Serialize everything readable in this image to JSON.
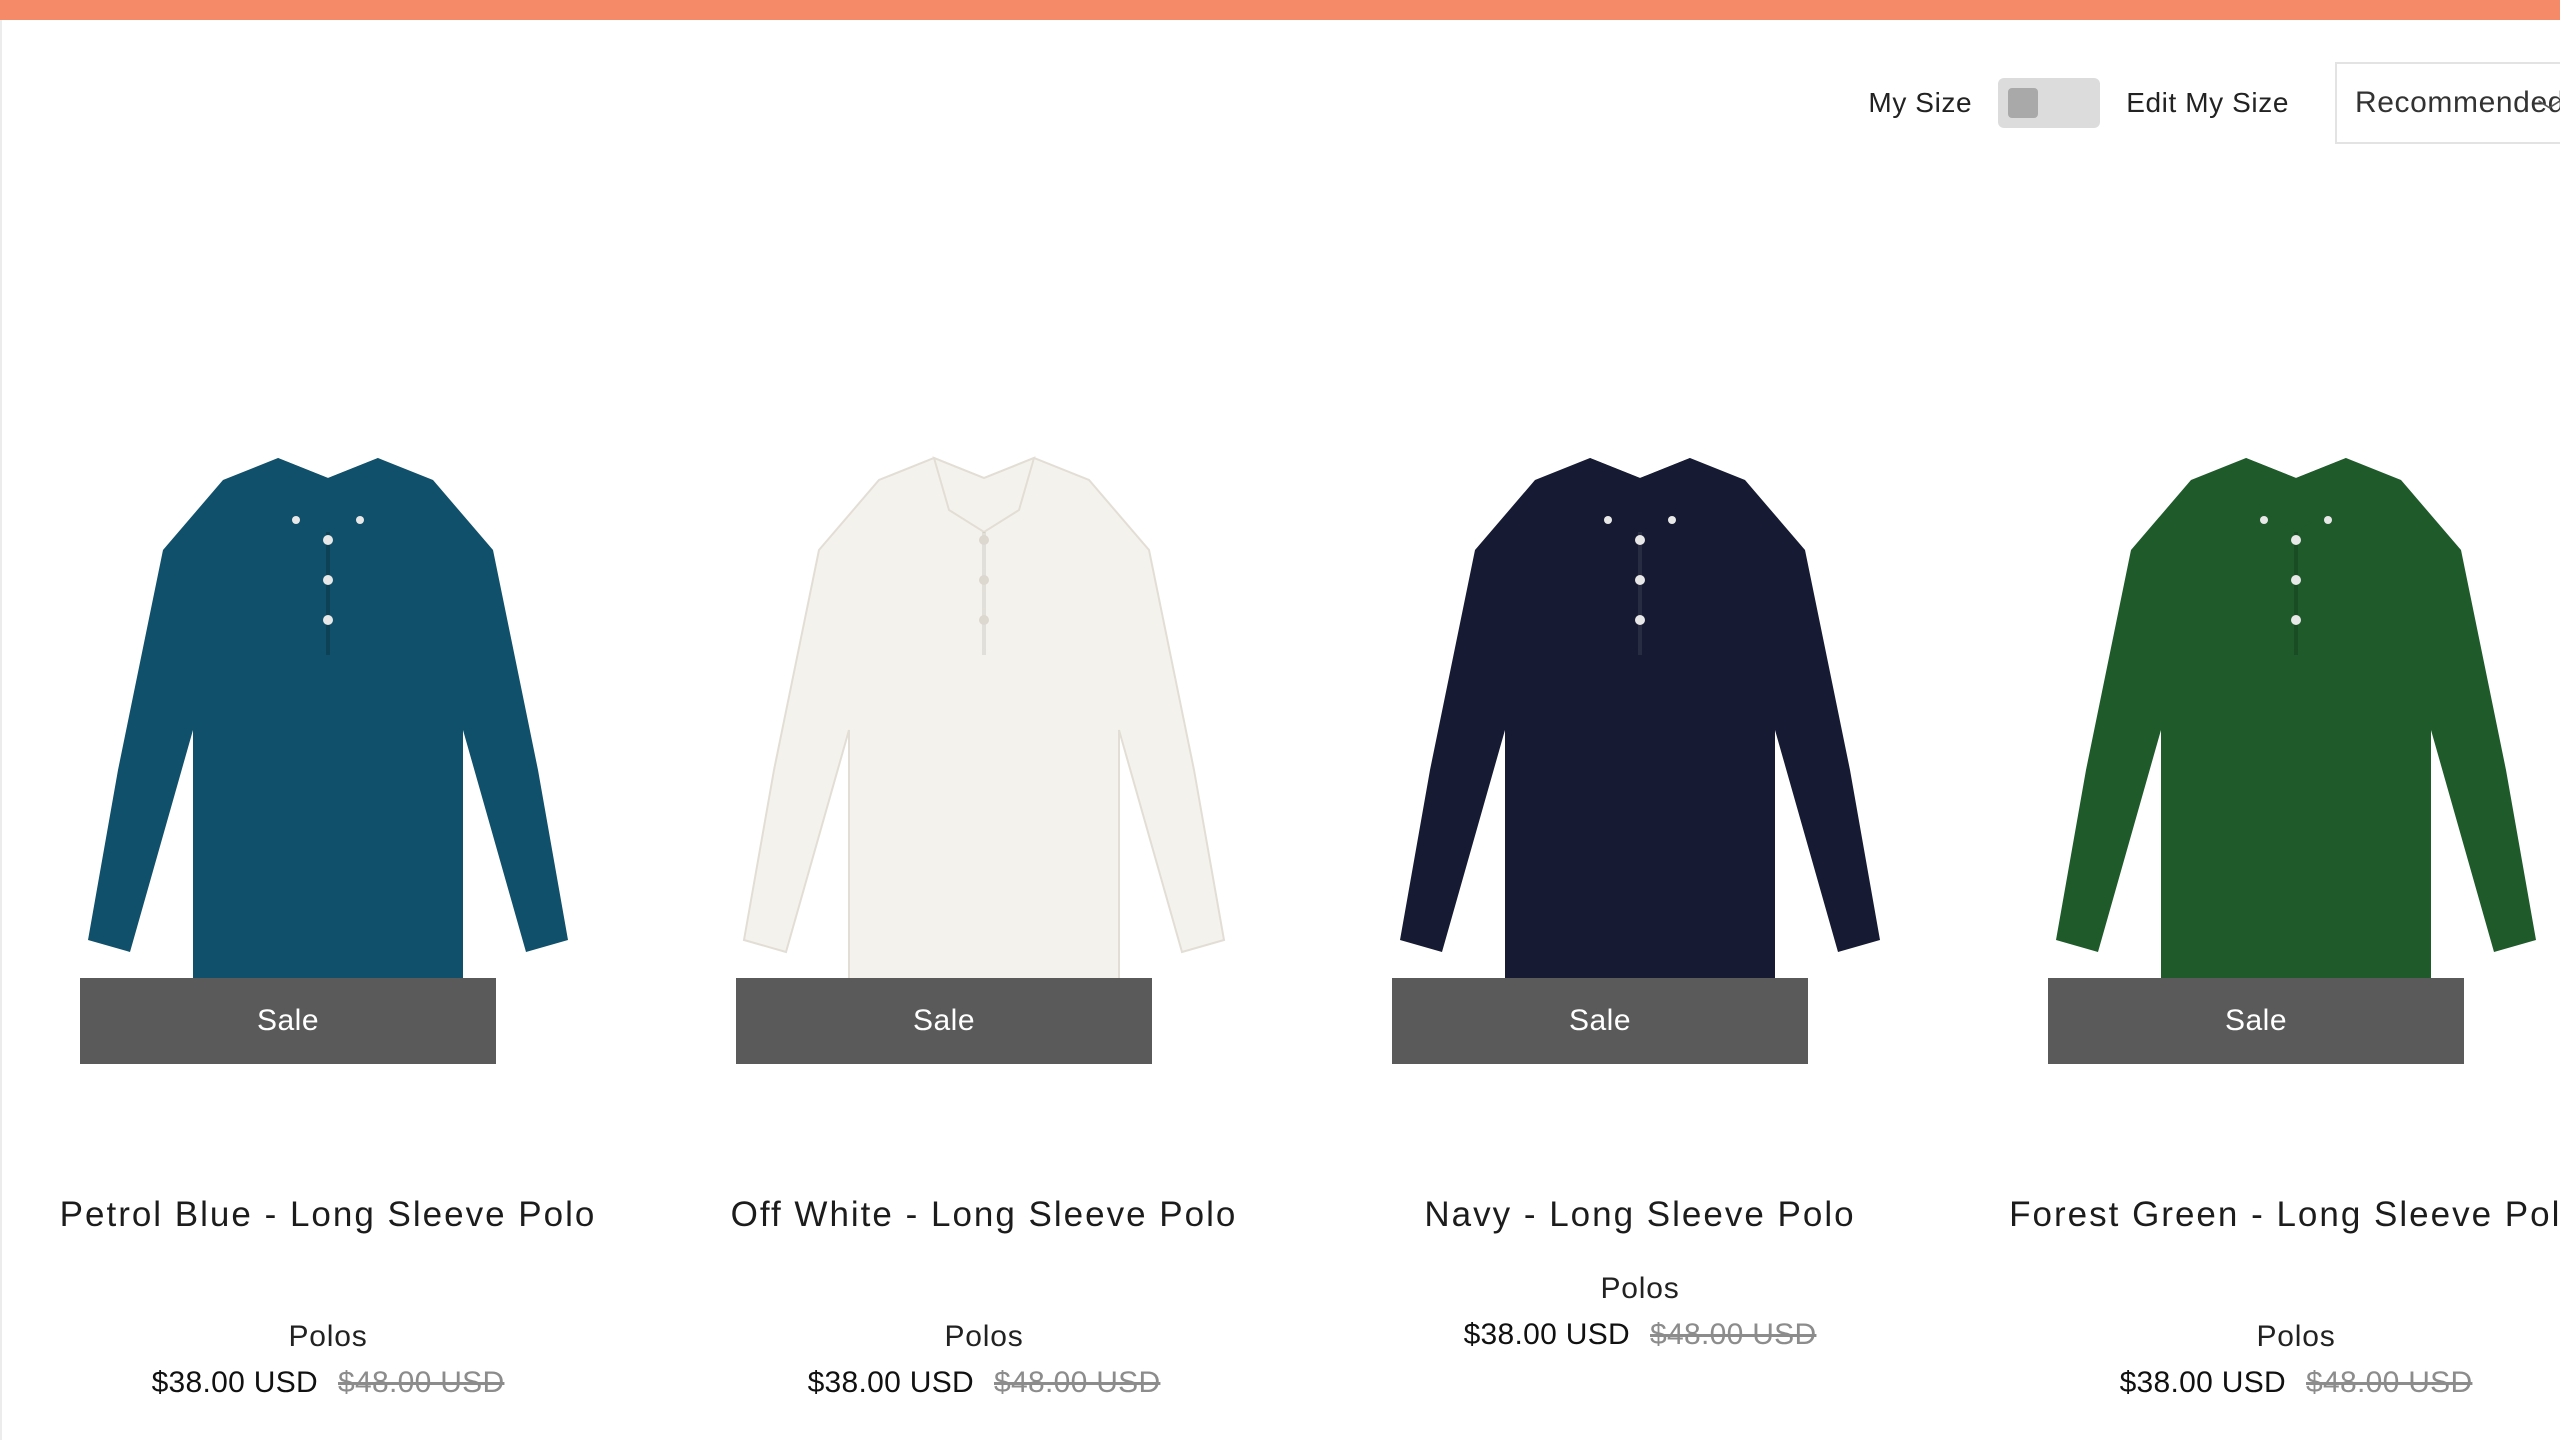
{
  "colors": {
    "top_bar": "#f58a68",
    "sale_badge": "#5a5a5a"
  },
  "toolbar": {
    "my_size_label": "My Size",
    "my_size_toggle_on": false,
    "edit_my_size_label": "Edit My Size",
    "sort_value": "Recommended"
  },
  "products": [
    {
      "name": "Petrol Blue - Long Sleeve Polo",
      "category": "Polos",
      "price": "$38.00 USD",
      "original_price": "$48.00 USD",
      "badge": "Sale",
      "color": "#10506a"
    },
    {
      "name": "Off White - Long Sleeve Polo",
      "category": "Polos",
      "price": "$38.00 USD",
      "original_price": "$48.00 USD",
      "badge": "Sale",
      "color": "#f4f2ec"
    },
    {
      "name": "Navy - Long Sleeve Polo",
      "category": "Polos",
      "price": "$38.00 USD",
      "original_price": "$48.00 USD",
      "badge": "Sale",
      "color": "#161b33"
    },
    {
      "name": "Forest Green - Long Sleeve Polo",
      "category": "Polos",
      "price": "$38.00 USD",
      "original_price": "$48.00 USD",
      "badge": "Sale",
      "color": "#1f5a2a"
    }
  ]
}
